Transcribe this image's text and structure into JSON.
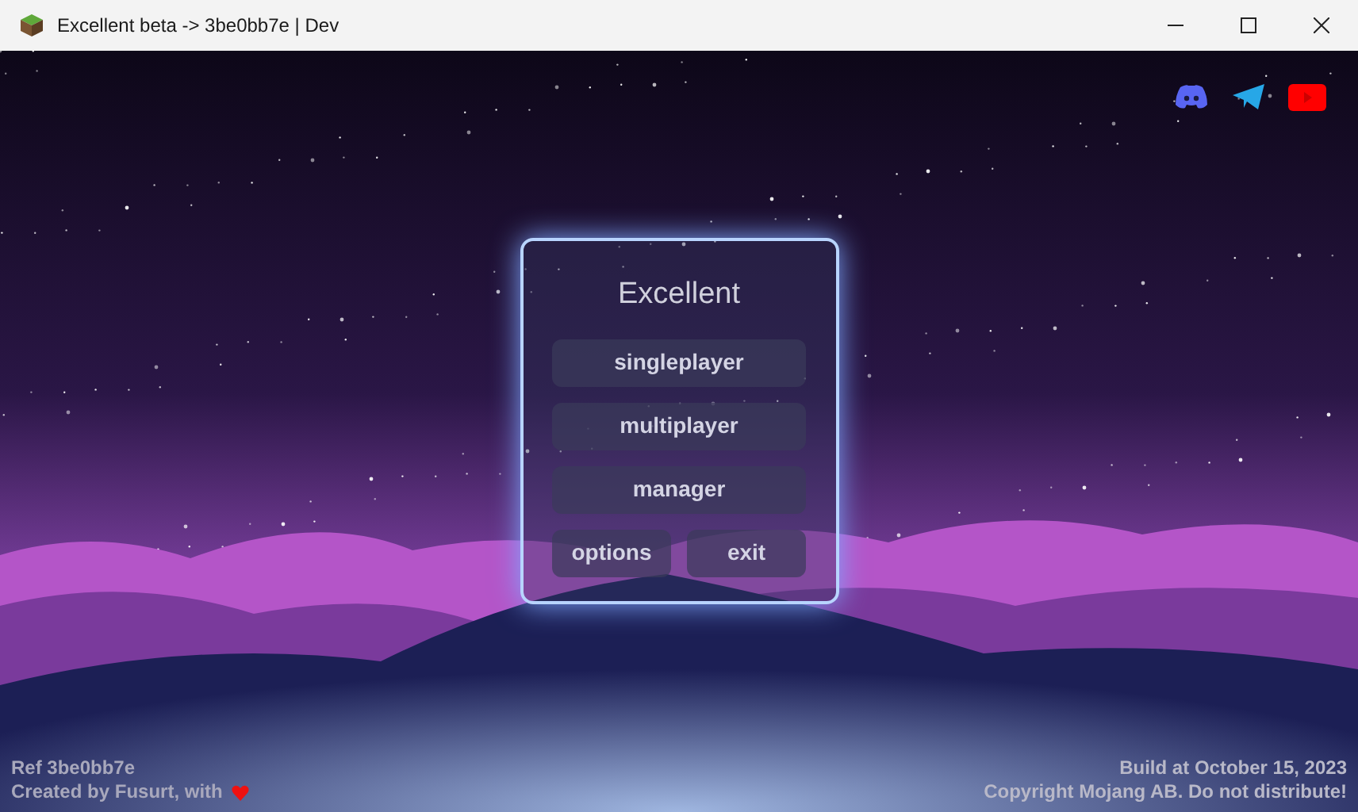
{
  "window": {
    "title": "Excellent beta -> 3be0bb7e | Dev"
  },
  "social_links": [
    {
      "kind": "discord"
    },
    {
      "kind": "telegram"
    },
    {
      "kind": "youtube"
    }
  ],
  "menu": {
    "title": "Excellent",
    "buttons": [
      {
        "label": "singleplayer"
      },
      {
        "label": "multiplayer"
      },
      {
        "label": "manager"
      }
    ],
    "bottom_buttons": [
      {
        "label": "options"
      },
      {
        "label": "exit"
      }
    ]
  },
  "footer_left": {
    "ref": "Ref **3be0bb7e**",
    "credits": "Created by **Fusurt**, with"
  },
  "footer_right": {
    "build": "Build at **October 15, 2023**",
    "copyright": "Copyright **Mojang AB.** Do not distribute!"
  }
}
